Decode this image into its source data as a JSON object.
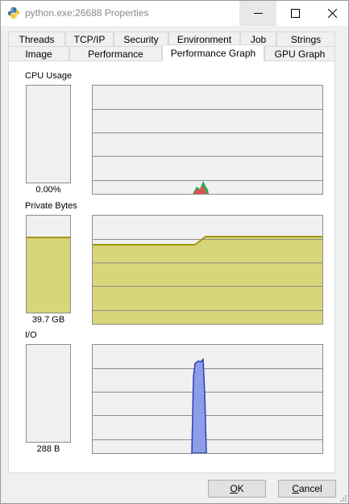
{
  "window": {
    "title": "python.exe:26688 Properties",
    "app_icon": "python-icon"
  },
  "tabs": {
    "row1": [
      {
        "label": "Threads"
      },
      {
        "label": "TCP/IP"
      },
      {
        "label": "Security"
      },
      {
        "label": "Environment"
      },
      {
        "label": "Job"
      },
      {
        "label": "Strings"
      }
    ],
    "row2": [
      {
        "label": "Image"
      },
      {
        "label": "Performance"
      },
      {
        "label": "Performance Graph",
        "active": true
      },
      {
        "label": "GPU Graph"
      }
    ]
  },
  "sections": {
    "cpu": {
      "label": "CPU Usage",
      "value": "0.00%",
      "meter_fraction": 0.0
    },
    "private_bytes": {
      "label": "Private Bytes",
      "value": "39.7 GB",
      "meter_fraction": 0.78
    },
    "io": {
      "label": "I/O",
      "value": "288 B",
      "meter_fraction": 0.0
    }
  },
  "buttons": {
    "ok": {
      "prefix": "",
      "mnemonic": "O",
      "rest": "K"
    },
    "cancel": {
      "prefix": "",
      "mnemonic": "C",
      "rest": "ancel"
    }
  },
  "colors": {
    "private_fill": "#d8d57a",
    "private_line": "#9d9a10",
    "cpu_total": "#2fa84f",
    "cpu_kernel": "#e05050",
    "io_fill": "#8d9ee8",
    "io_line": "#2f3fb5",
    "grid": "#8c8c8c",
    "graph_bg": "#f0f0f0"
  }
}
